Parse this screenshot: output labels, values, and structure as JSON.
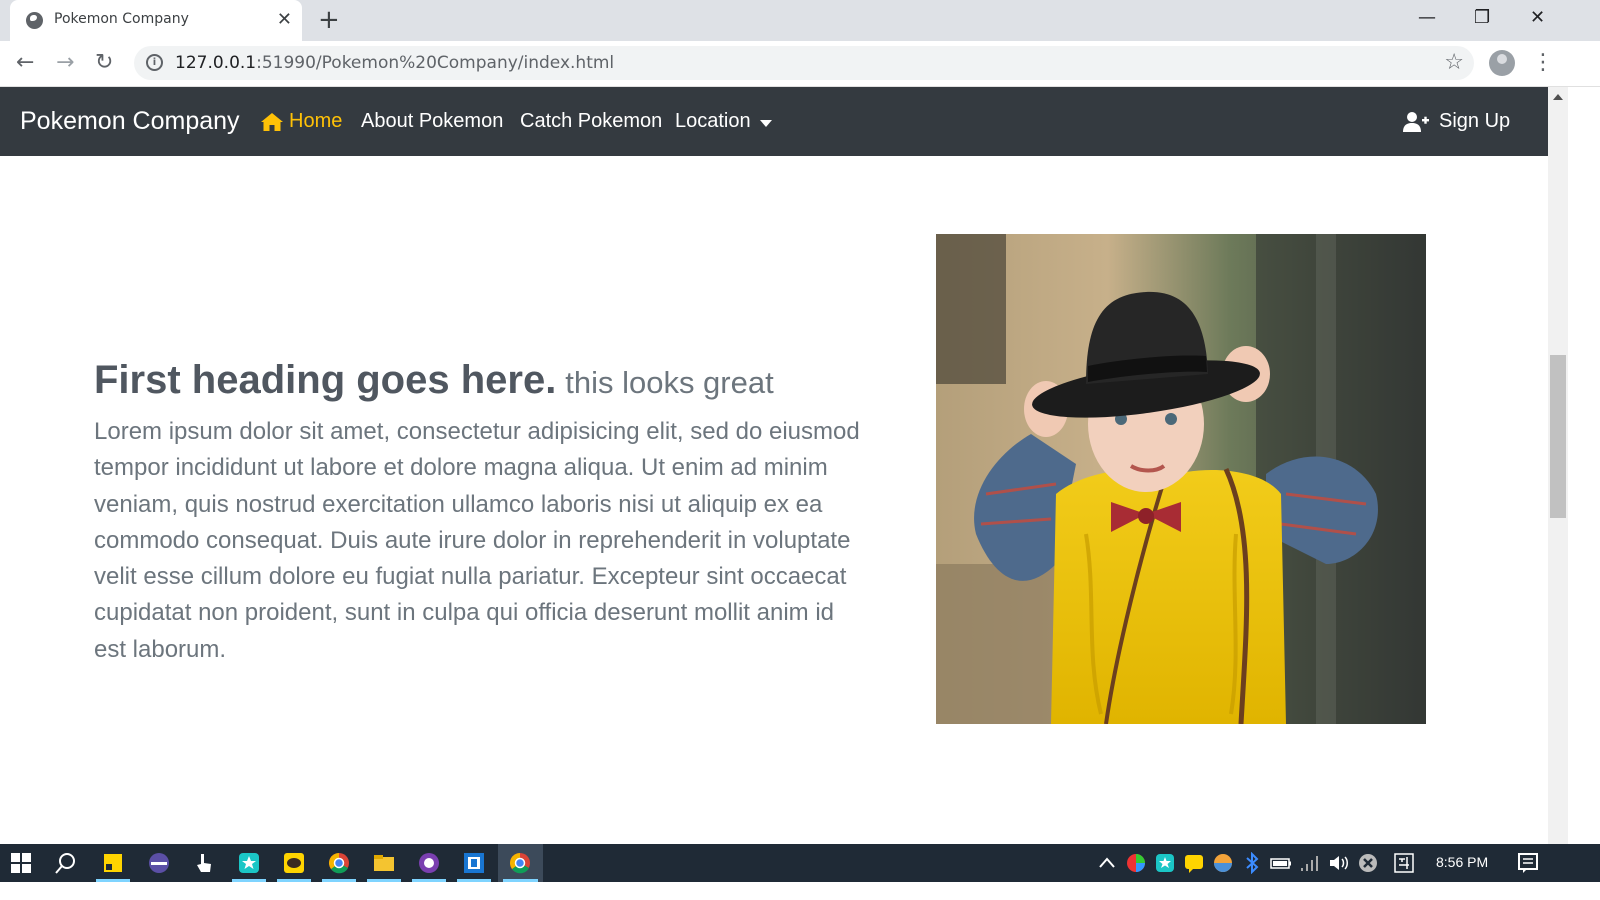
{
  "browser": {
    "tab_title": "Pokemon Company",
    "tab_close": "✕",
    "new_tab": "+",
    "url_host": "127.0.0.1",
    "url_rest": ":51990/Pokemon%20Company/index.html",
    "back": "←",
    "forward": "→",
    "reload": "↻",
    "bookmark": "☆",
    "menu": "⋮",
    "minimize": "—",
    "maximize": "❐",
    "close": "✕"
  },
  "navbar": {
    "brand": "Pokemon Company",
    "links": [
      {
        "label": "Home",
        "active": true,
        "icon": "home-icon"
      },
      {
        "label": "About Pokemon",
        "active": false
      },
      {
        "label": "Catch Pokemon",
        "active": false
      },
      {
        "label": "Location",
        "active": false,
        "dropdown": true
      }
    ],
    "signup": {
      "label": "Sign Up",
      "icon": "user-plus-icon"
    },
    "colors": {
      "background": "#343a40",
      "active": "#ffc107",
      "text": "#ffffff"
    }
  },
  "content": {
    "heading": "First heading goes here.",
    "heading_muted": "this looks great",
    "paragraph": "Lorem ipsum dolor sit amet, consectetur adipisicing elit, sed do eiusmod tempor incididunt ut labore et dolore magna aliqua. Ut enim ad minim veniam, quis nostrud exercitation ullamco laboris nisi ut aliquip ex ea commodo consequat. Duis aute irure dolor in reprehenderit in voluptate velit esse cillum dolore eu fugiat nulla pariatur. Excepteur sint occaecat cupidatat non proident, sunt in culpa qui officia deserunt mollit anim id est laborum."
  },
  "taskbar": {
    "time": "8:56 PM"
  }
}
